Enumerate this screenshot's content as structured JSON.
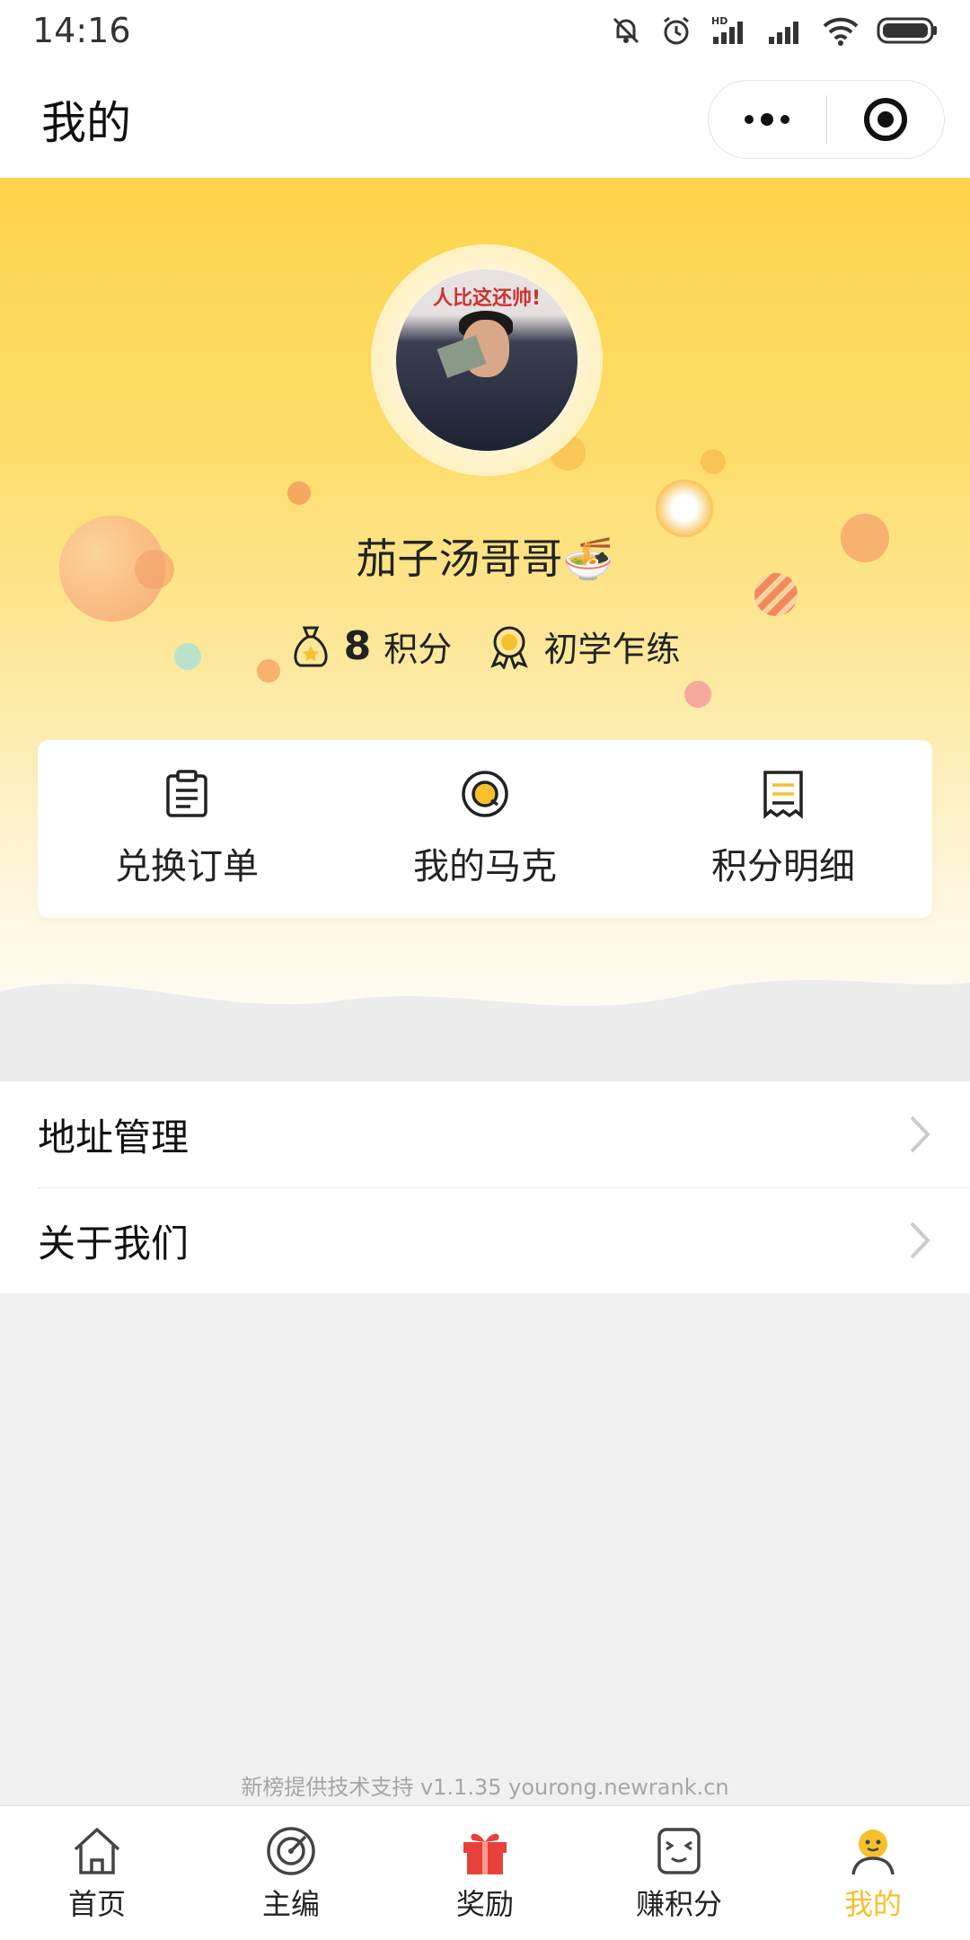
{
  "status_bar": {
    "time": "14:16"
  },
  "title_bar": {
    "title": "我的"
  },
  "profile": {
    "avatar_caption": "人比这还帅!",
    "username": "茄子汤哥哥🍜",
    "points_value": "8",
    "points_label": "积分",
    "level": "初学乍练"
  },
  "quick_actions": [
    {
      "label": "兑换订单",
      "icon": "clipboard-icon"
    },
    {
      "label": "我的马克",
      "icon": "mark-coin-icon"
    },
    {
      "label": "积分明细",
      "icon": "receipt-icon"
    }
  ],
  "menu": [
    {
      "label": "地址管理"
    },
    {
      "label": "关于我们"
    }
  ],
  "footer": {
    "text": "新榜提供技术支持 v1.1.35  yourong.newrank.cn"
  },
  "tabs": [
    {
      "label": "首页",
      "icon": "home-icon",
      "active": false
    },
    {
      "label": "主编",
      "icon": "radar-icon",
      "active": false
    },
    {
      "label": "奖励",
      "icon": "gift-icon",
      "active": false
    },
    {
      "label": "赚积分",
      "icon": "smile-box-icon",
      "active": false
    },
    {
      "label": "我的",
      "icon": "user-icon",
      "active": true
    }
  ],
  "colors": {
    "accent": "#f5c12e",
    "hero_top": "#fdd34a",
    "gift_red": "#e8413c"
  }
}
